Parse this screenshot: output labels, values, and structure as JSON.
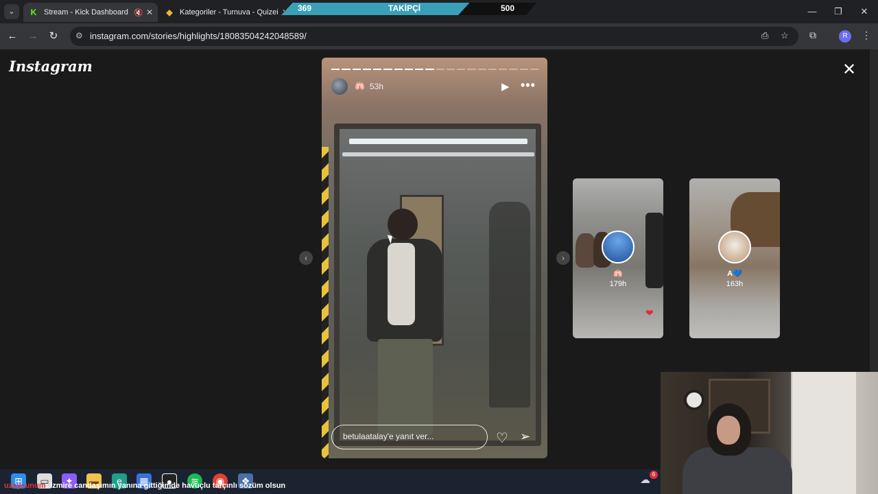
{
  "browser": {
    "tabs": [
      {
        "title": "Stream - Kick Dashboard",
        "favicon": "kick-icon",
        "color": "#53fc18"
      },
      {
        "title": "Kategoriler - Turnuva - Quizei",
        "favicon": "quiz-icon"
      }
    ],
    "url": "instagram.com/stories/highlights/18083504242048589/",
    "profile_initial": "R"
  },
  "overlay": {
    "current": "369",
    "label": "TAKİPÇİ",
    "goal": "500",
    "progress_fraction": 0.738
  },
  "instagram": {
    "logo": "Instagram",
    "story": {
      "time": "53h",
      "emoji": "🫁",
      "progress_total": 20,
      "progress_done": 10,
      "reply_placeholder": "betulaatalay'e yanıt ver..."
    },
    "previews": [
      {
        "emoji": "🫁",
        "time": "179h"
      },
      {
        "name": "A💙",
        "time": "163h"
      }
    ]
  },
  "chat": {
    "user": "uzaysunum",
    "message": ": izmire candaşımın yanına gittiğimde havuçlu tarçınlı sözüm olsun"
  },
  "taskbar": {
    "notification_count": "6"
  }
}
